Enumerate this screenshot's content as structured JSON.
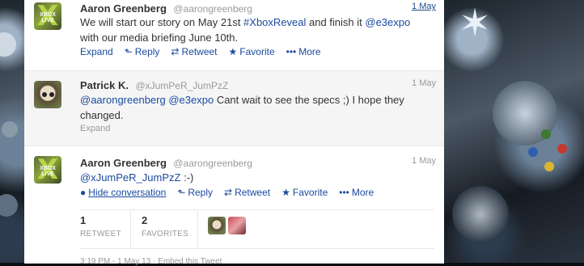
{
  "tweets": [
    {
      "fullname": "Aaron Greenberg",
      "username": "@aarongreenberg",
      "time": "1 May",
      "text_parts": [
        "We will start our story on May 21st ",
        "#XboxReveal",
        " and finish it ",
        "@e3expo",
        " with our media briefing June 10th."
      ],
      "actions": {
        "expand": "Expand",
        "reply": "Reply",
        "retweet": "Retweet",
        "favorite": "Favorite",
        "more": "More"
      }
    },
    {
      "fullname": "Patrick K.",
      "username": "@xJumPeR_JumPzZ",
      "time": "1 May",
      "text_parts": [
        "@aarongreenberg",
        " ",
        "@e3expo",
        " Cant wait to see the specs ;) I hope they changed."
      ],
      "actions": {
        "expand": "Expand"
      }
    },
    {
      "fullname": "Aaron Greenberg",
      "username": "@aarongreenberg",
      "time": "1 May",
      "text_parts": [
        "@xJumPeR_JumPzZ",
        " :-)"
      ],
      "actions": {
        "hide": "Hide conversation",
        "reply": "Reply",
        "retweet": "Retweet",
        "favorite": "Favorite",
        "more": "More"
      }
    }
  ],
  "stats": {
    "retweets": {
      "num": "1",
      "label": "RETWEET"
    },
    "favorites": {
      "num": "2",
      "label": "FAVORITES"
    }
  },
  "avatar_text": "XBOX LIVE",
  "footer_peek": "3:19 PM - 1 May 13 · Embed this Tweet",
  "colors": {
    "link": "#1a4aa0",
    "muted": "#999999",
    "text": "#333333"
  }
}
